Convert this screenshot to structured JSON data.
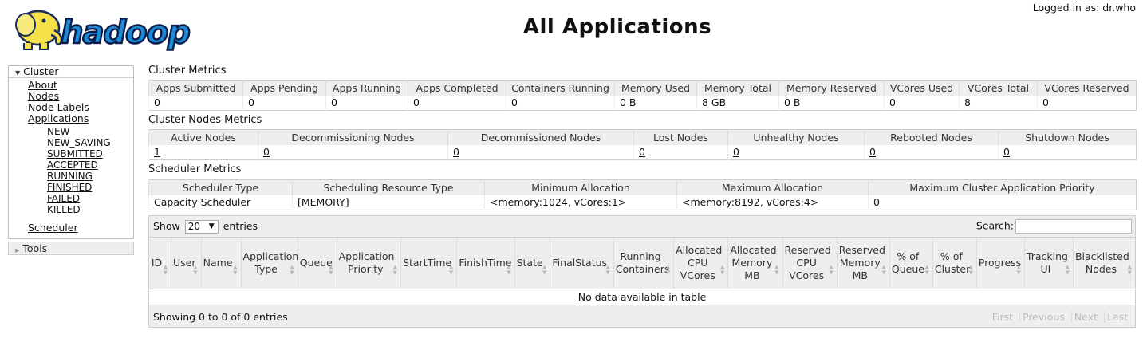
{
  "header": {
    "logo_text": "hadoop",
    "title": "All Applications",
    "user_label": "Logged in as: dr.who"
  },
  "nav": {
    "cluster_label": "Cluster",
    "items": [
      "About",
      "Nodes",
      "Node Labels",
      "Applications"
    ],
    "app_states": [
      "NEW",
      "NEW_SAVING",
      "SUBMITTED",
      "ACCEPTED",
      "RUNNING",
      "FINISHED",
      "FAILED",
      "KILLED"
    ],
    "scheduler_label": "Scheduler",
    "tools_label": "Tools"
  },
  "cluster_metrics": {
    "title": "Cluster Metrics",
    "headers": [
      "Apps Submitted",
      "Apps Pending",
      "Apps Running",
      "Apps Completed",
      "Containers Running",
      "Memory Used",
      "Memory Total",
      "Memory Reserved",
      "VCores Used",
      "VCores Total",
      "VCores Reserved"
    ],
    "values": [
      "0",
      "0",
      "0",
      "0",
      "0",
      "0 B",
      "8 GB",
      "0 B",
      "0",
      "8",
      "0"
    ]
  },
  "nodes_metrics": {
    "title": "Cluster Nodes Metrics",
    "headers": [
      "Active Nodes",
      "Decommissioning Nodes",
      "Decommissioned Nodes",
      "Lost Nodes",
      "Unhealthy Nodes",
      "Rebooted Nodes",
      "Shutdown Nodes"
    ],
    "values": [
      "1",
      "0",
      "0",
      "0",
      "0",
      "0",
      "0"
    ]
  },
  "scheduler_metrics": {
    "title": "Scheduler Metrics",
    "headers": [
      "Scheduler Type",
      "Scheduling Resource Type",
      "Minimum Allocation",
      "Maximum Allocation",
      "Maximum Cluster Application Priority"
    ],
    "values": [
      "Capacity Scheduler",
      "[MEMORY]",
      "<memory:1024, vCores:1>",
      "<memory:8192, vCores:4>",
      "0"
    ]
  },
  "apps_table": {
    "show_label": "Show",
    "entries_label": "entries",
    "page_size": "20",
    "search_label": "Search:",
    "search_value": "",
    "columns": [
      "ID",
      "User",
      "Name",
      "Application Type",
      "Queue",
      "Application Priority",
      "StartTime",
      "FinishTime",
      "State",
      "FinalStatus",
      "Running Containers",
      "Allocated CPU VCores",
      "Allocated Memory MB",
      "Reserved CPU VCores",
      "Reserved Memory MB",
      "% of Queue",
      "% of Cluster",
      "Progress",
      "Tracking UI",
      "Blacklisted Nodes"
    ],
    "empty_text": "No data available in table",
    "info_text": "Showing 0 to 0 of 0 entries",
    "paging": [
      "First",
      "Previous",
      "Next",
      "Last"
    ]
  },
  "colors": {
    "header_bg": "#eeeeee",
    "border": "#cccccc",
    "logo_fill": "#1a8bd8",
    "elephant": "#f7e14a"
  }
}
